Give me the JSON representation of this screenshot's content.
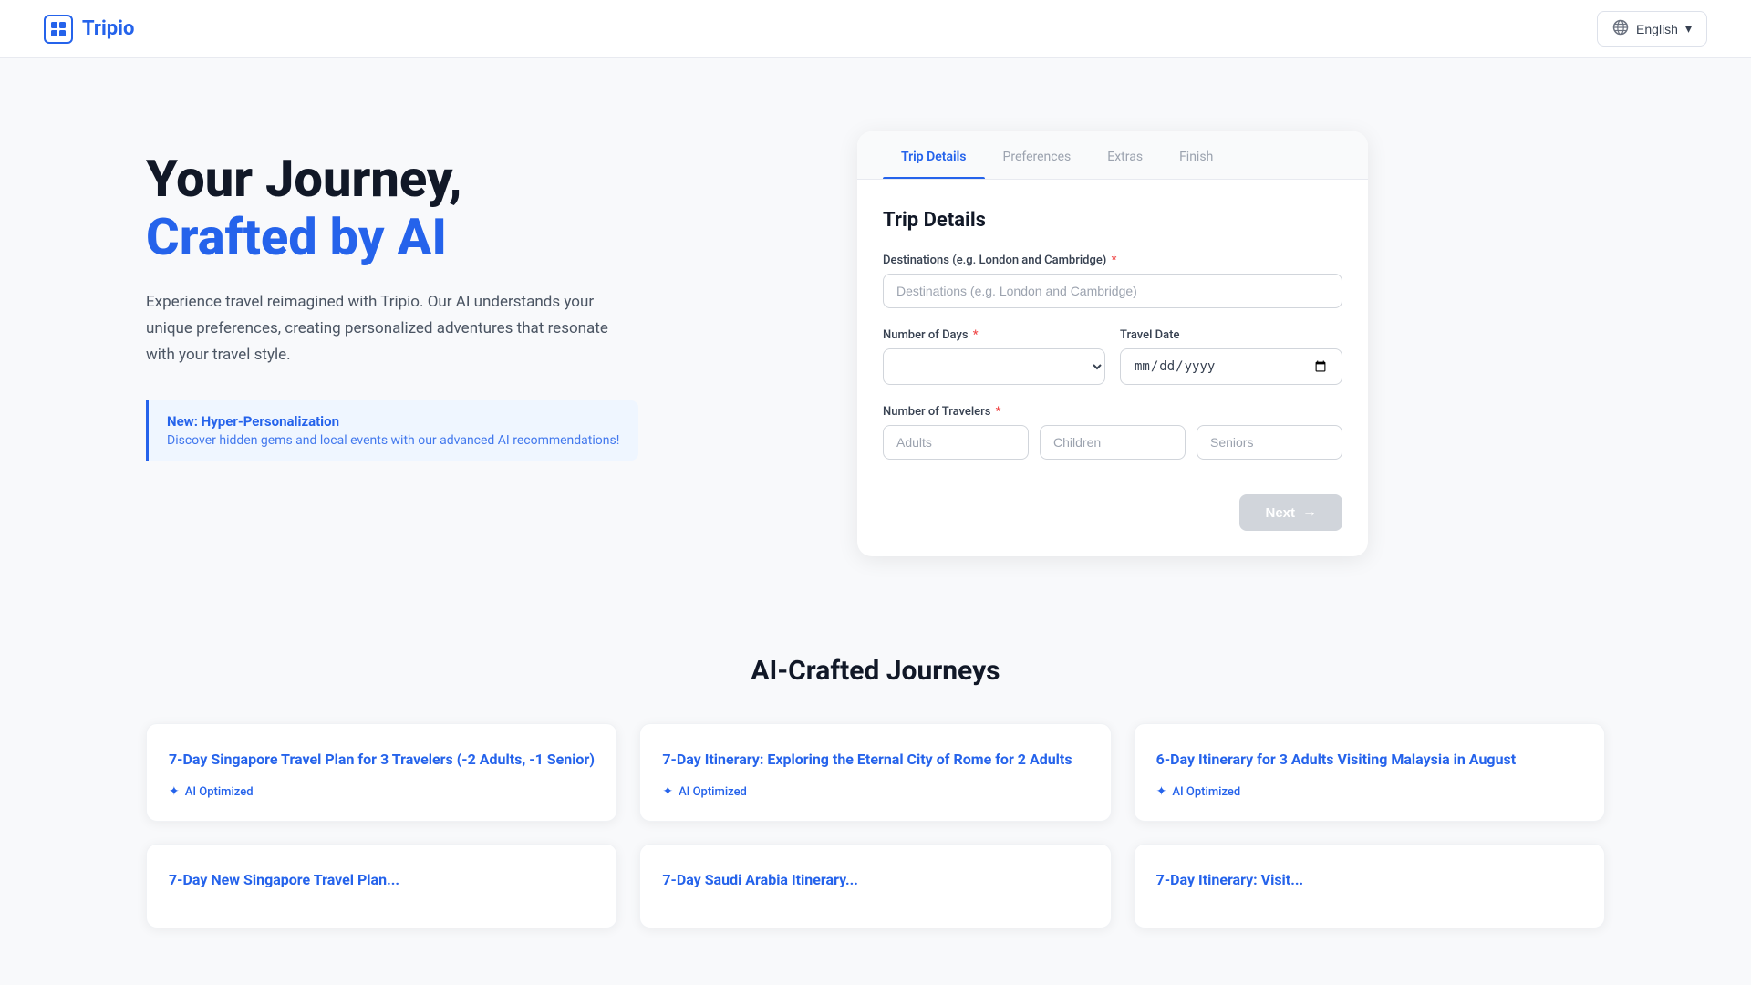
{
  "header": {
    "logo_text": "Tripio",
    "logo_icon": "⊞",
    "lang_label": "English",
    "lang_chevron": "▾"
  },
  "hero": {
    "title_line1": "Your Journey,",
    "title_line2": "Crafted by AI",
    "description": "Experience travel reimagined with Tripio. Our AI understands your unique preferences, creating personalized adventures that resonate with your travel style.",
    "banner_title": "New: Hyper-Personalization",
    "banner_sub": "Discover hidden gems and local events with our advanced AI recommendations!"
  },
  "form": {
    "section_title": "Trip Details",
    "tabs": [
      {
        "label": "Trip Details",
        "active": true
      },
      {
        "label": "Preferences",
        "active": false
      },
      {
        "label": "Extras",
        "active": false
      },
      {
        "label": "Finish",
        "active": false
      }
    ],
    "destinations_label": "Destinations (e.g. London and Cambridge)",
    "destinations_placeholder": "Destinations (e.g. London and Cambridge)",
    "days_label": "Number of Days",
    "days_required": "*",
    "travel_date_label": "Travel Date",
    "travel_date_placeholder": "mm/dd/yyyy",
    "travelers_label": "Number of Travelers",
    "travelers_required": "*",
    "adults_placeholder": "Adults",
    "children_placeholder": "Children",
    "seniors_placeholder": "Seniors",
    "next_label": "Next",
    "next_arrow": "→"
  },
  "bottom": {
    "section_title": "AI-Crafted Journeys",
    "cards": [
      {
        "title": "7-Day Singapore Travel Plan for 3 Travelers (-2 Adults, -1 Senior)",
        "badge": "AI Optimized"
      },
      {
        "title": "7-Day Itinerary: Exploring the Eternal City of Rome for 2 Adults",
        "badge": "AI Optimized"
      },
      {
        "title": "6-Day Itinerary for 3 Adults Visiting Malaysia in August",
        "badge": "AI Optimized"
      }
    ],
    "partial_cards": [
      {
        "title": "7-Day New Singapore Travel Plan..."
      },
      {
        "title": "7-Day Saudi Arabia Itinerary..."
      },
      {
        "title": "7-Day Itinerary: Visit..."
      }
    ]
  }
}
